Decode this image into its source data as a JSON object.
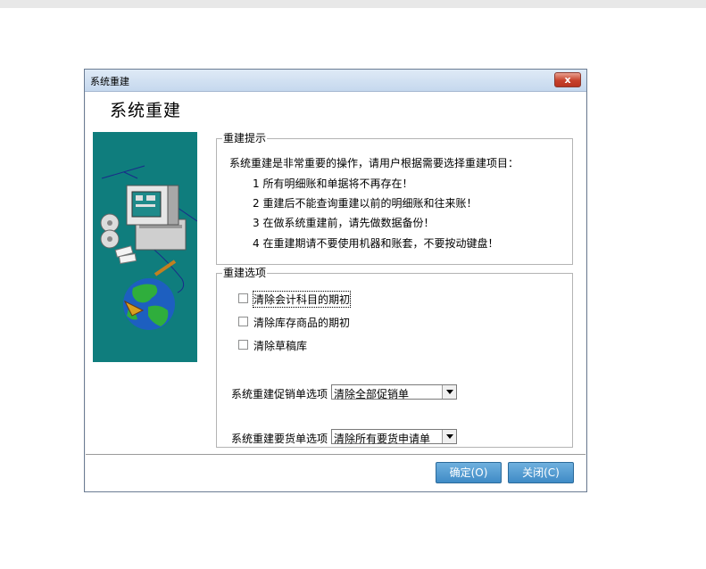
{
  "window": {
    "title": "系统重建",
    "close_label": "x",
    "heading": "系统重建"
  },
  "tips": {
    "legend": "重建提示",
    "intro": "系统重建是非常重要的操作，请用户根据需要选择重建项目：",
    "items": [
      "1 所有明细账和单据将不再存在！",
      "2 重建后不能查询重建以前的明细账和往来账！",
      "3 在做系统重建前，请先做数据备份！",
      "4 在重建期请不要使用机器和账套，不要按动键盘！"
    ]
  },
  "options": {
    "legend": "重建选项",
    "checkboxes": [
      {
        "label": "清除会计科目的期初",
        "checked": false
      },
      {
        "label": "清除库存商品的期初",
        "checked": false
      },
      {
        "label": "清除草稿库",
        "checked": false
      }
    ],
    "promo_label": "系统重建促销单选项",
    "promo_value": "清除全部促销单",
    "order_label": "系统重建要货单选项",
    "order_value": "清除所有要货申请单"
  },
  "buttons": {
    "ok": "确定(O)",
    "close": "关闭(C)"
  },
  "colors": {
    "art_background": "#0f7d7d",
    "button": "#4a95cf",
    "close_button": "#c7412b"
  }
}
